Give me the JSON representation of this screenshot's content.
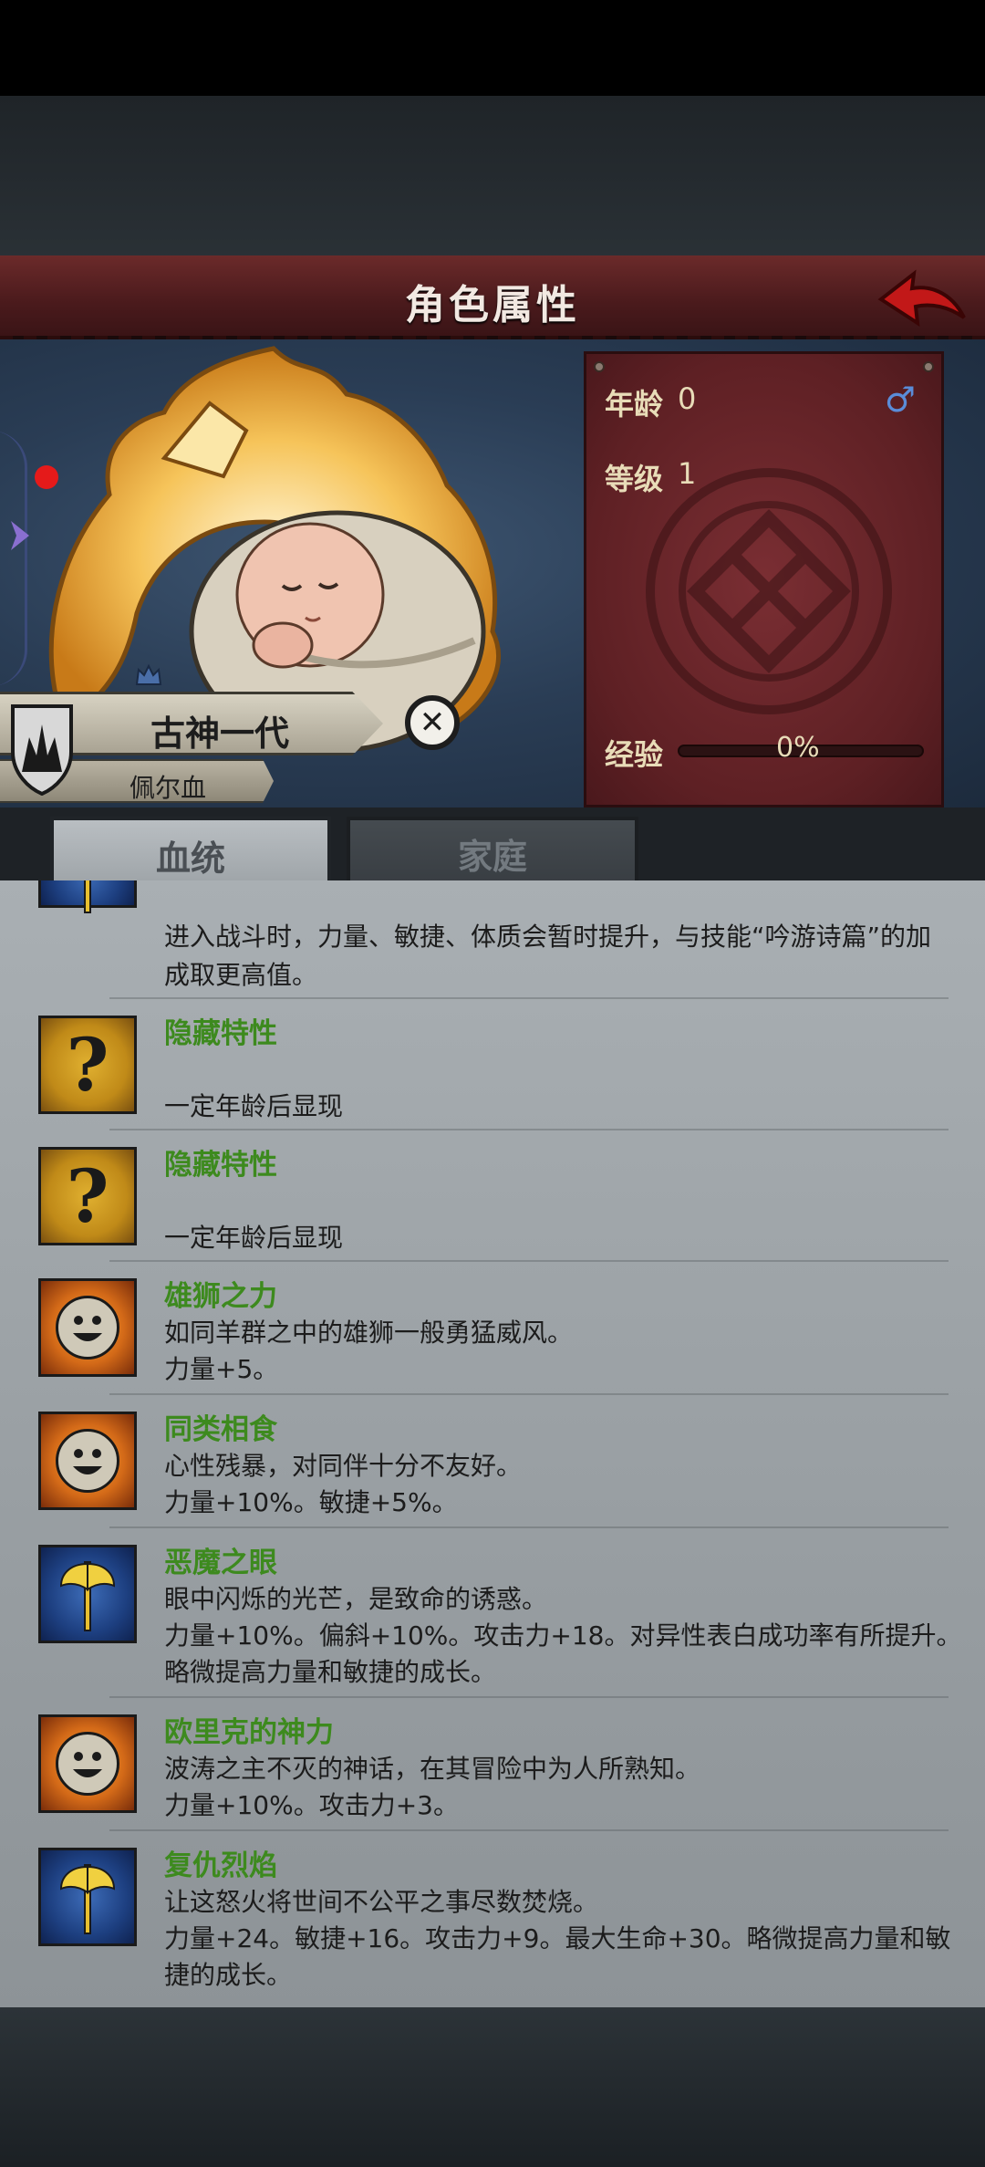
{
  "header": {
    "title": "角色属性"
  },
  "character": {
    "name": "古神一代",
    "bloodline": "佩尔血"
  },
  "stats": {
    "age_label": "年龄",
    "age_value": "0",
    "level_label": "等级",
    "level_value": "1",
    "exp_label": "经验",
    "exp_value": "0%",
    "exp_fraction": 0,
    "gender_symbol": "♂"
  },
  "tabs": [
    {
      "label": "血统",
      "active": true
    },
    {
      "label": "家庭",
      "active": false
    }
  ],
  "traits_partial": {
    "line1": "进入战斗时，力量、敏捷、体质会暂时提升，与技能“吟游诗篇”的加",
    "line2": "成取更高值。"
  },
  "traits": [
    {
      "icon": "question-icon",
      "name": "隐藏特性",
      "lines": [
        "",
        "一定年龄后显现"
      ]
    },
    {
      "icon": "question-icon",
      "name": "隐藏特性",
      "lines": [
        "",
        "一定年龄后显现"
      ]
    },
    {
      "icon": "smile-sun-icon",
      "name": "雄狮之力",
      "lines": [
        "如同羊群之中的雄狮一般勇猛威风。",
        "力量+5。"
      ]
    },
    {
      "icon": "smile-sun-icon",
      "name": "同类相食",
      "lines": [
        "心性残暴，对同伴十分不友好。",
        "力量+10%。敏捷+5%。"
      ]
    },
    {
      "icon": "axe-icon",
      "name": "恶魔之眼",
      "lines": [
        "眼中闪烁的光芒，是致命的诱惑。",
        "力量+10%。偏斜+10%。攻击力+18。对异性表白成功率有所提升。",
        "略微提高力量和敏捷的成长。"
      ]
    },
    {
      "icon": "smile-sun-icon",
      "name": "欧里克的神力",
      "lines": [
        "波涛之主不灭的神话，在其冒险中为人所熟知。",
        "力量+10%。攻击力+3。"
      ]
    },
    {
      "icon": "axe-icon",
      "name": "复仇烈焰",
      "lines": [
        "让这怒火将世间不公平之事尽数焚烧。",
        "力量+24。敏捷+16。攻击力+9。最大生命+30。略微提高力量和敏",
        "捷的成长。"
      ]
    }
  ],
  "colors": {
    "trait_name": "#3d8a1e",
    "title_banner": "#5a2224",
    "stats_panel": "#6a2529"
  }
}
